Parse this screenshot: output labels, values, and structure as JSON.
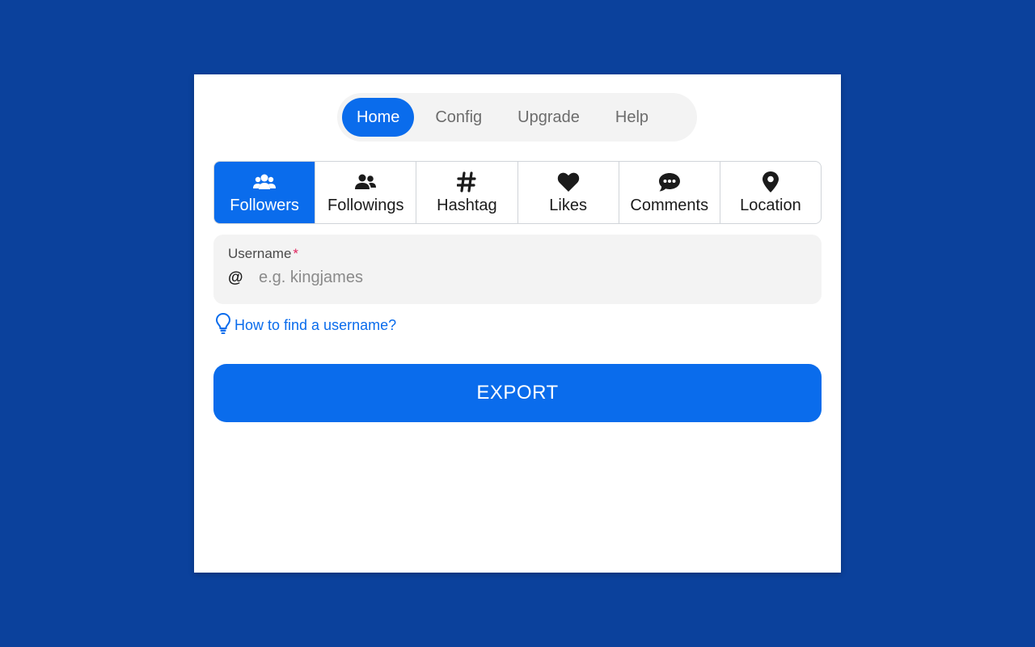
{
  "nav": {
    "items": [
      {
        "label": "Home",
        "active": true
      },
      {
        "label": "Config",
        "active": false
      },
      {
        "label": "Upgrade",
        "active": false
      },
      {
        "label": "Help",
        "active": false
      }
    ]
  },
  "tabs": {
    "items": [
      {
        "label": "Followers",
        "icon": "users-icon",
        "active": true
      },
      {
        "label": "Followings",
        "icon": "user-friends-icon",
        "active": false
      },
      {
        "label": "Hashtag",
        "icon": "hashtag-icon",
        "active": false
      },
      {
        "label": "Likes",
        "icon": "heart-icon",
        "active": false
      },
      {
        "label": "Comments",
        "icon": "comment-dots-icon",
        "active": false
      },
      {
        "label": "Location",
        "icon": "map-marker-icon",
        "active": false
      }
    ]
  },
  "form": {
    "username_label": "Username",
    "required_mark": "*",
    "prefix": "@",
    "placeholder": "e.g. kingjames",
    "value": ""
  },
  "help": {
    "link_text": "How to find a username?",
    "icon": "lightbulb-icon"
  },
  "actions": {
    "export_label": "EXPORT"
  },
  "colors": {
    "background": "#0b419c",
    "accent": "#0a6cec",
    "required": "#e0245e"
  }
}
